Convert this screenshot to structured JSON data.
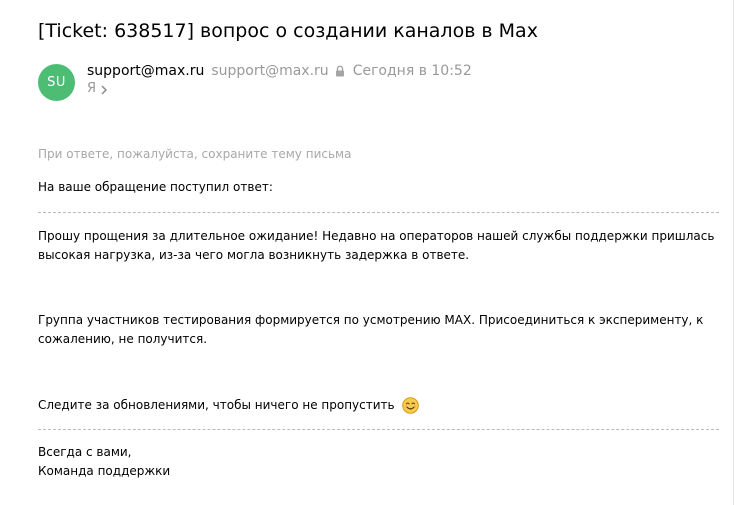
{
  "email": {
    "subject": "[Ticket: 638517] вопрос о создании каналов в Max",
    "avatar_initials": "SU",
    "avatar_color": "#4cbd73",
    "sender_name": "support@max.ru",
    "sender_email": "support@max.ru",
    "date": "Сегодня в 10:52",
    "recipient": "Я",
    "icons": {
      "lock": "lock-icon",
      "chevron": "chevron-right-icon",
      "emoji": "smile-icon"
    }
  },
  "body": {
    "hint": "При ответе, пожалуйста, сохраните тему письма",
    "intro": "На ваше обращение поступил ответ:",
    "para1_line1": "Прошу прощения за длительное ожидание! Недавно на операторов нашей службы поддержки пришлась",
    "para1_line2": "высокая нагрузка, из-за чего могла возникнуть задержка в ответе.",
    "para2_line1": "Группа участников тестирования формируется по усмотрению MAX. Присоединиться к эксперименту, к",
    "para2_line2": "сожалению, не получится.",
    "para3": "Следите за обновлениями, чтобы ничего не пропустить",
    "signature_line1": "Всегда с вами,",
    "signature_line2": "Команда поддержки"
  }
}
